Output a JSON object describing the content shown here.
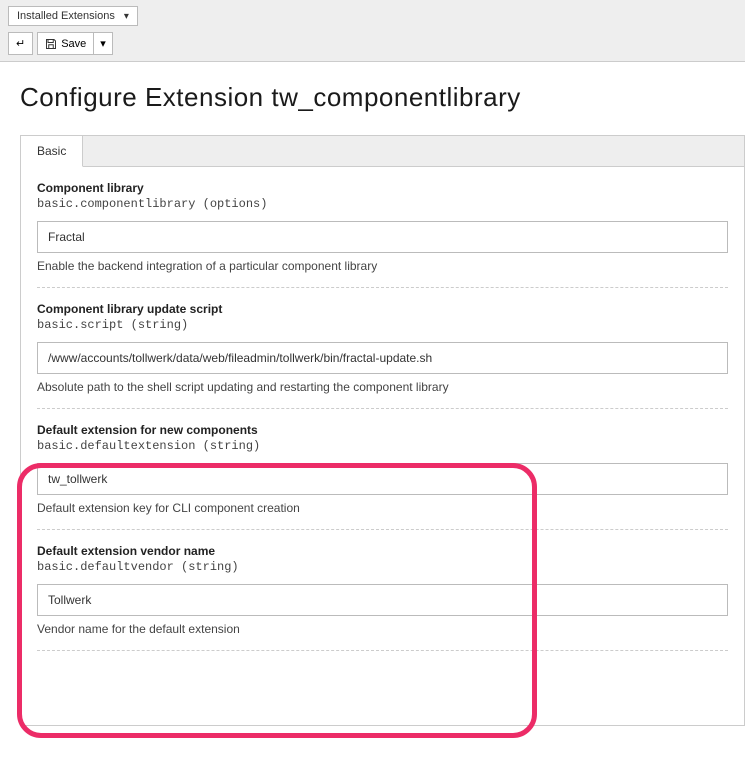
{
  "topbar": {
    "breadcrumb_select": "Installed Extensions",
    "save_label": "Save"
  },
  "page_title": "Configure Extension tw_componentlibrary",
  "tabs": [
    {
      "label": "Basic"
    }
  ],
  "fields": [
    {
      "title": "Component library",
      "key": "basic.componentlibrary (options)",
      "value": "Fractal",
      "desc": "Enable the backend integration of a particular component library"
    },
    {
      "title": "Component library update script",
      "key": "basic.script (string)",
      "value": "/www/accounts/tollwerk/data/web/fileadmin/tollwerk/bin/fractal-update.sh",
      "desc": "Absolute path to the shell script updating and restarting the component library"
    },
    {
      "title": "Default extension for new components",
      "key": "basic.defaultextension (string)",
      "value": "tw_tollwerk",
      "desc": "Default extension key for CLI component creation"
    },
    {
      "title": "Default extension vendor name",
      "key": "basic.defaultvendor (string)",
      "value": "Tollwerk",
      "desc": "Vendor name for the default extension"
    }
  ]
}
